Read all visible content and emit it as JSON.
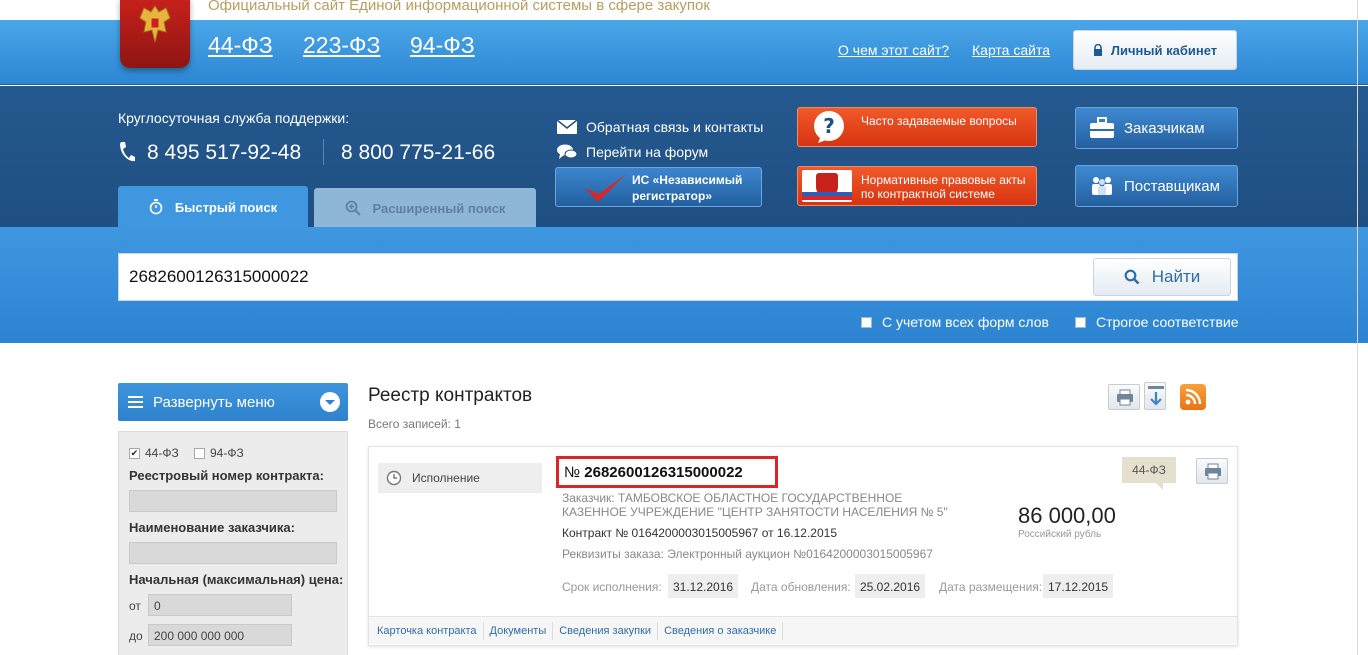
{
  "header": {
    "site_title": "Официальный сайт Единой информационной системы в сфере закупок",
    "laws": [
      "44-ФЗ",
      "223-ФЗ",
      "94-ФЗ"
    ],
    "about_link": "О чем этот сайт?",
    "sitemap_link": "Карта сайта",
    "cabinet_button": "Личный кабинет"
  },
  "support": {
    "label": "Круглосуточная служба поддержки:",
    "phone1": "8 495 517-92-48",
    "phone2": "8 800 775-21-66",
    "feedback": "Обратная связь и контакты",
    "forum": "Перейти на форум",
    "registrator": "ИС «Независимый регистратор»",
    "faq": "Часто задаваемые вопросы",
    "legal_acts": "Нормативные правовые акты по контрактной системе",
    "customers": "Заказчикам",
    "suppliers": "Поставщикам"
  },
  "tabs": {
    "quick": "Быстрый поиск",
    "advanced": "Расширенный поиск"
  },
  "search": {
    "value": "2682600126315000022",
    "button": "Найти",
    "option_forms": "С учетом всех форм слов",
    "option_strict": "Строгое соответствие"
  },
  "sidebar": {
    "menu_button": "Развернуть меню",
    "check_44": "44-ФЗ",
    "check_94": "94-ФЗ",
    "check_44_checked": true,
    "check_94_checked": false,
    "registry_number_label": "Реестровый номер контракта:",
    "customer_name_label": "Наименование заказчика:",
    "price_label": "Начальная (максимальная) цена:",
    "from_label": "от",
    "from_value": "0",
    "to_label": "до",
    "to_value": "200 000 000 000"
  },
  "registry": {
    "title": "Реестр контрактов",
    "total": "Всего записей: 1"
  },
  "contract": {
    "status": "Исполнение",
    "number_prefix": "№",
    "number": "2682600126315000022",
    "customer": "Заказчик: ТАМБОВСКОЕ ОБЛАСТНОЕ ГОСУДАРСТВЕННОЕ КАЗЕННОЕ УЧРЕЖДЕНИЕ \"ЦЕНТР ЗАНЯТОСТИ НАСЕЛЕНИЯ № 5\"",
    "contract_line": "Контракт № 0164200003015005967 от 16.12.2015",
    "requisites": "Реквизиты заказа: Электронный аукцион №0164200003015005967",
    "price": "86 000,00",
    "currency": "Российский рубль",
    "law_badge": "44-ФЗ",
    "exec_label": "Срок исполнения:",
    "exec_date": "31.12.2016",
    "update_label": "Дата обновления:",
    "update_date": "25.02.2016",
    "publish_label": "Дата размещения:",
    "publish_date": "17.12.2015",
    "links": [
      "Карточка контракта",
      "Документы",
      "Сведения закупки",
      "Сведения о заказчике"
    ]
  },
  "colors": {
    "header_blue": "#2d86d3",
    "navy": "#1f4f82",
    "accent_red": "#d9262b",
    "orange_button": "#e0411a"
  }
}
